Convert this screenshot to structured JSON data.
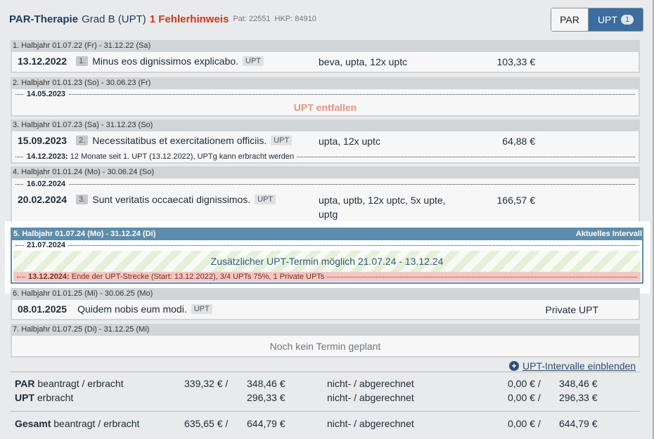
{
  "header": {
    "title": "PAR-Therapie",
    "grade": "Grad B (UPT)",
    "error": "1 Fehlerhinweis",
    "patient": "Pat: 22551",
    "hkp": "HKP: 84910",
    "toggle_par": "PAR",
    "toggle_upt": "UPT",
    "toggle_badge": "1"
  },
  "sections": [
    {
      "head": "1. Halbjahr 01.07.22 (Fr) - 31.12.22 (Sa)",
      "date": "13.12.2022",
      "num": "1.",
      "desc": "Minus eos dignissimos explicabo.",
      "tag": "UPT",
      "proc": "beva, upta, 12x uptc",
      "amount": "103,33 €"
    },
    {
      "head": "2. Halbjahr 01.01.23 (So) - 30.06.23 (Fr)",
      "marker": "14.05.2023",
      "notice": "UPT entfallen"
    },
    {
      "head": "3. Halbjahr 01.07.23 (Sa) - 31.12.23 (So)",
      "date": "15.09.2023",
      "num": "2.",
      "desc": "Necessitatibus et exercitationem officiis.",
      "tag": "UPT",
      "proc": "upta, 12x uptc",
      "amount": "64,88 €",
      "marker": "14.12.2023:",
      "marker_note": "12 Monate seit 1. UPT (13.12.2022), UPTg kann erbracht werden"
    },
    {
      "head": "4. Halbjahr 01.01.24 (Mo) - 30.06.24 (So)",
      "marker": "16.02.2024",
      "date": "20.02.2024",
      "num": "3.",
      "desc": "Sunt veritatis occaecati dignissimos.",
      "tag": "UPT",
      "proc": "upta, uptb, 12x uptc, 5x upte,",
      "proc2": "uptg",
      "amount": "166,57 €"
    },
    {
      "head": "5. Halbjahr 01.07.24 (Mo) - 31.12.24 (Di)",
      "current_label": "Aktuelles Intervall",
      "marker": "21.07.2024",
      "possible": "Zusätzlicher UPT-Termin möglich 21.07.24 - 13.12.24",
      "end_marker": "13.12.2024:",
      "end_note": "Ende der UPT-Strecke (Start: 13.12.2022), 3/4 UPTs 75%, 1 Private UPTs"
    },
    {
      "head": "6. Halbjahr 01.01.25 (Mi) - 30.06.25 (Mo)",
      "date": "08.01.2025",
      "desc": "Quidem nobis eum modi.",
      "tag": "UPT",
      "private": "Private UPT"
    },
    {
      "head": "7. Halbjahr 01.07.25 (Di) - 31.12.25 (Mi)",
      "empty": "Noch kein Termin geplant"
    }
  ],
  "upt_link": "UPT-Intervalle einblenden",
  "summary": {
    "par_label": "PAR",
    "par_rest": "beantragt / erbracht",
    "par_beantragt": "339,32 € /",
    "par_erbracht": "348,46 €",
    "par_status": "nicht- / abgerechnet",
    "par_nicht": "0,00 € /",
    "par_abger": "348,46 €",
    "upt_label": "UPT",
    "upt_rest": "erbracht",
    "upt_erbracht": "296,33 €",
    "upt_status": "nicht- / abgerechnet",
    "upt_nicht": "0,00 € /",
    "upt_abger": "296,33 €",
    "ges_label": "Gesamt",
    "ges_rest": "beantragt / erbracht",
    "ges_beantragt": "635,65 € /",
    "ges_erbracht": "644,79 €",
    "ges_status": "nicht- / abgerechnet",
    "ges_nicht": "0,00 € /",
    "ges_abger": "644,79 €"
  }
}
